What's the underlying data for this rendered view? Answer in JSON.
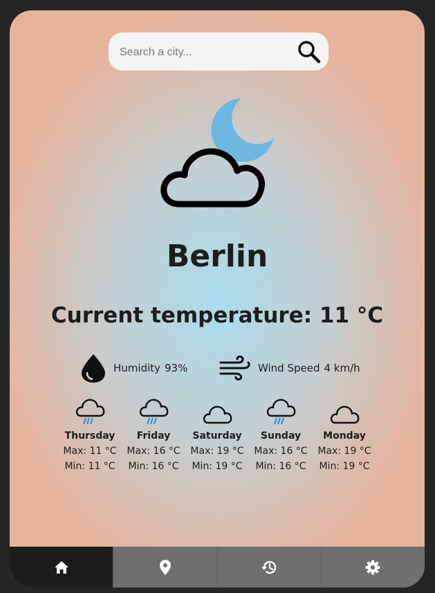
{
  "search": {
    "placeholder": "Search a city..."
  },
  "weather": {
    "city": "Berlin",
    "current_temperature": "Current temperature: 11 °C",
    "icon": "cloud-moon-icon",
    "humidity_label": "Humidity",
    "humidity_value": "93%",
    "wind_label": "Wind Speed",
    "wind_value": "4 km/h"
  },
  "forecast": [
    {
      "day": "Thursday",
      "max": "Max: 11 °C",
      "min": "Min: 11 °C",
      "icon": "rain-cloud-icon"
    },
    {
      "day": "Friday",
      "max": "Max: 16 °C",
      "min": "Min: 16 °C",
      "icon": "rain-cloud-icon"
    },
    {
      "day": "Saturday",
      "max": "Max: 19 °C",
      "min": "Min: 19 °C",
      "icon": "cloud-icon"
    },
    {
      "day": "Sunday",
      "max": "Max: 16 °C",
      "min": "Min: 16 °C",
      "icon": "rain-cloud-icon"
    },
    {
      "day": "Monday",
      "max": "Max: 19 °C",
      "min": "Min: 19 °C",
      "icon": "cloud-icon"
    }
  ],
  "nav": [
    {
      "icon": "home-icon",
      "active": true
    },
    {
      "icon": "location-pin-icon",
      "active": false
    },
    {
      "icon": "history-icon",
      "active": false
    },
    {
      "icon": "gear-icon",
      "active": false
    }
  ],
  "colors": {
    "moon": "#6bb7e0",
    "rain": "#3a8fd8",
    "nav_active": "#1c1c1c",
    "nav": "#6f6f6f"
  }
}
